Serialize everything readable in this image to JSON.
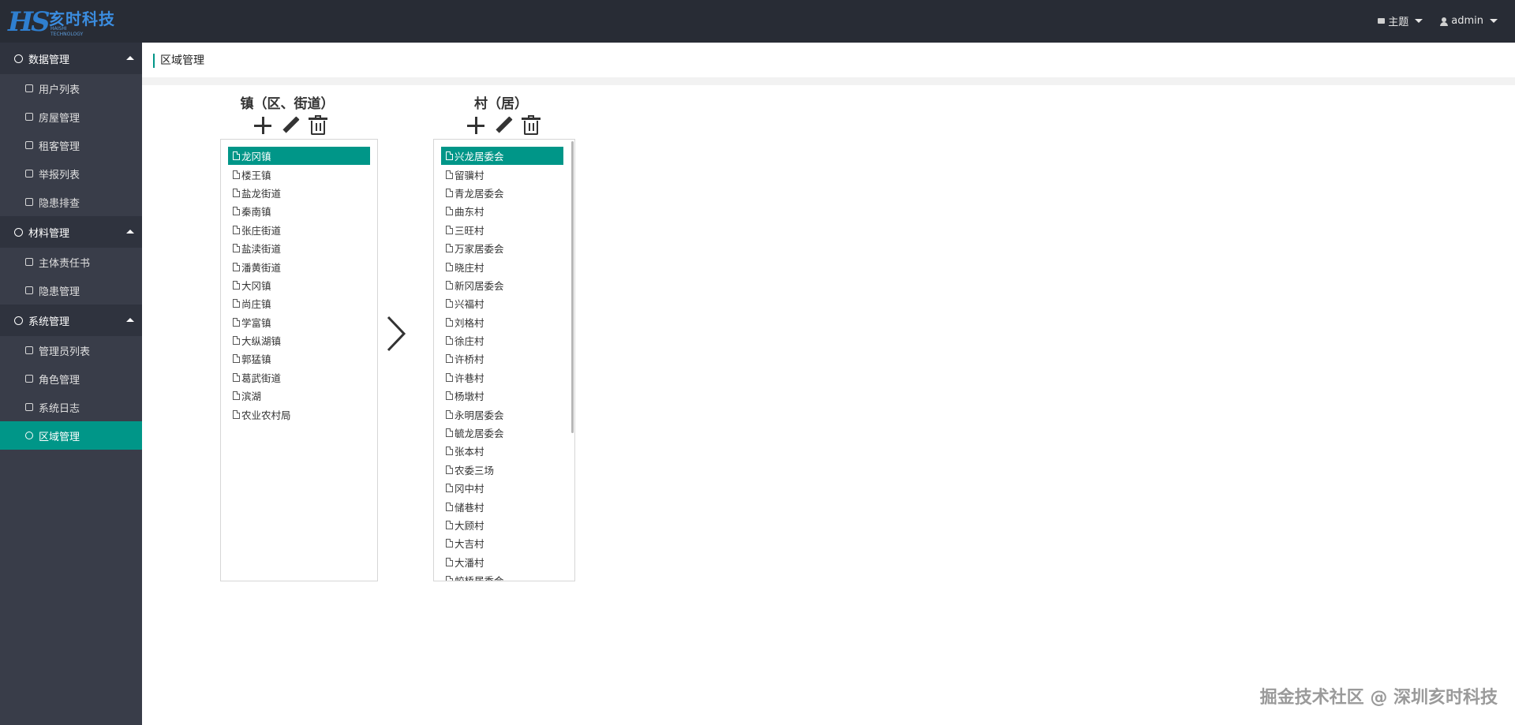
{
  "header": {
    "logo_mark": "HS",
    "logo_name": "亥时科技",
    "logo_sub": "HAISHI TECHNOLOGY",
    "theme_label": "主题",
    "user_label": "admin"
  },
  "sidebar": {
    "groups": [
      {
        "label": "数据管理",
        "items": [
          "用户列表",
          "房屋管理",
          "租客管理",
          "举报列表",
          "隐患排查"
        ]
      },
      {
        "label": "材料管理",
        "items": [
          "主体责任书",
          "隐患管理"
        ]
      },
      {
        "label": "系统管理",
        "items": [
          "管理员列表",
          "角色管理",
          "系统日志",
          "区域管理"
        ]
      }
    ],
    "active_item": "区域管理"
  },
  "breadcrumb": "区域管理",
  "towns": {
    "title": "镇（区、街道）",
    "items": [
      "龙冈镇",
      "楼王镇",
      "盐龙街道",
      "秦南镇",
      "张庄街道",
      "盐渎街道",
      "潘黄街道",
      "大冈镇",
      "尚庄镇",
      "学富镇",
      "大纵湖镇",
      "郭猛镇",
      "葛武街道",
      "滨湖",
      "农业农村局"
    ],
    "selected": "龙冈镇"
  },
  "villages": {
    "title": "村（居）",
    "items": [
      "兴龙居委会",
      "留骥村",
      "青龙居委会",
      "曲东村",
      "三旺村",
      "万家居委会",
      "晓庄村",
      "新冈居委会",
      "兴福村",
      "刘格村",
      "徐庄村",
      "许桥村",
      "许巷村",
      "杨墩村",
      "永明居委会",
      "毓龙居委会",
      "张本村",
      "农委三场",
      "冈中村",
      "储巷村",
      "大顾村",
      "大吉村",
      "大潘村",
      "蛟桥居委会"
    ],
    "selected": "兴龙居委会"
  },
  "watermark": "掘金技术社区 @ 深圳亥时科技"
}
